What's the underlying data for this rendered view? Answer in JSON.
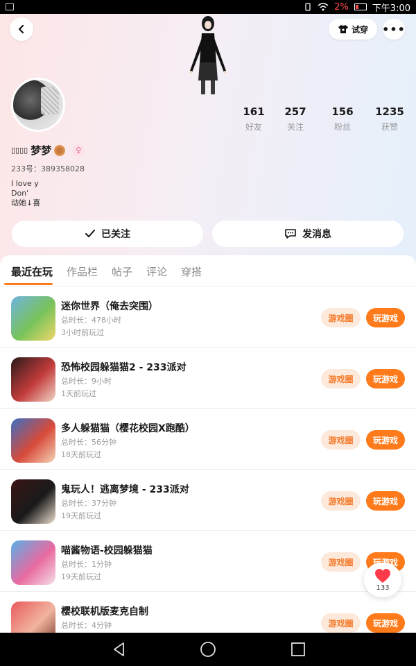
{
  "status_bar": {
    "battery_percent": "2%",
    "time": "下午3:00",
    "icons": [
      "image-icon",
      "vibrate-icon",
      "wifi-icon",
      "battery-icon"
    ]
  },
  "header": {
    "try_on_label": "试穿",
    "more_label": "•••"
  },
  "stats": [
    {
      "value": "161",
      "label": "好友"
    },
    {
      "value": "257",
      "label": "关注"
    },
    {
      "value": "156",
      "label": "粉丝"
    },
    {
      "value": "1235",
      "label": "获赞"
    }
  ],
  "profile": {
    "nickname_prefix": "▯▯▯▯",
    "nickname": "梦梦",
    "gender_icon": "female-icon",
    "uid": "233号：389358028",
    "bio_lines": [
      "I love y",
      "Don'",
      "动她↓喜"
    ]
  },
  "actions": {
    "follow_label": "已关注",
    "message_label": "发消息"
  },
  "tabs": [
    "最近在玩",
    "作品栏",
    "帖子",
    "评论",
    "穿搭"
  ],
  "active_tab_index": 0,
  "game_button_labels": {
    "circle": "游戏圈",
    "play": "玩游戏"
  },
  "games": [
    {
      "title": "迷你世界（俺去突围）",
      "duration": "总时长：478小时",
      "last_played": "3小时前玩过",
      "icon_colors": [
        "#6fb3e0",
        "#79c35a",
        "#f0d86a"
      ]
    },
    {
      "title": "恐怖校园躲猫猫2 - 233派对",
      "duration": "总时长：9小时",
      "last_played": "1天前玩过",
      "icon_colors": [
        "#2a1a1a",
        "#c23b3b",
        "#f2d6c8"
      ]
    },
    {
      "title": "多人躲猫猫（樱花校园X跑酷）",
      "duration": "总时长：56分钟",
      "last_played": "18天前玩过",
      "icon_colors": [
        "#3a6fc2",
        "#d84a3a",
        "#f4d4b8"
      ]
    },
    {
      "title": "鬼玩人！逃离梦境 - 233派对",
      "duration": "总时长：37分钟",
      "last_played": "19天前玩过",
      "icon_colors": [
        "#3b1515",
        "#1a1a1a",
        "#f0e0d0"
      ]
    },
    {
      "title": "喵酱物语-校园躲猫猫",
      "duration": "总时长：1分钟",
      "last_played": "19天前玩过",
      "icon_colors": [
        "#5ab0e8",
        "#e86aa0",
        "#f6e0e8"
      ]
    },
    {
      "title": "樱校联机版麦克自制",
      "duration": "总时长：4分钟",
      "last_played": "",
      "icon_colors": [
        "#e85a5a",
        "#f2b4a0",
        "#7a3a2a"
      ]
    }
  ],
  "like_float": {
    "count": "133"
  },
  "colors": {
    "accent": "#ff7a1a",
    "circle_button_bg": "#fde9dc",
    "circle_button_text": "#f47a2a",
    "like_red": "#ff3b4b"
  }
}
